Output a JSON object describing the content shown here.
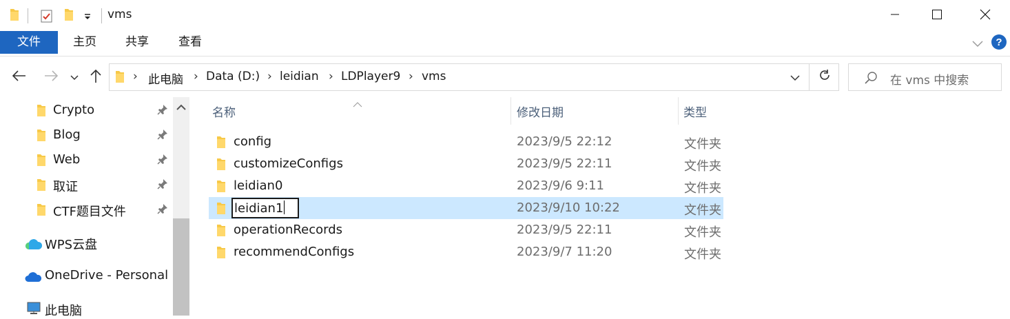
{
  "window": {
    "title": "vms",
    "icons": [
      "folder-icon",
      "properties-icon",
      "new-folder-icon",
      "customize-dropdown-icon"
    ],
    "controls": [
      "minimize-icon",
      "maximize-icon",
      "close-icon"
    ]
  },
  "ribbon": {
    "tabs": [
      {
        "label": "文件",
        "active": true
      },
      {
        "label": "主页"
      },
      {
        "label": "共享"
      },
      {
        "label": "查看"
      }
    ],
    "accent_color": "#1e66c0"
  },
  "address": {
    "breadcrumbs": [
      "此电脑",
      "Data (D:)",
      "leidian",
      "LDPlayer9",
      "vms"
    ],
    "search_placeholder": "在 vms 中搜索"
  },
  "navpane": {
    "quick_access": [
      {
        "label": "Crypto",
        "pinned": true
      },
      {
        "label": "Blog",
        "pinned": true
      },
      {
        "label": "Web",
        "pinned": true
      },
      {
        "label": "取证",
        "pinned": true
      },
      {
        "label": "CTF题目文件",
        "pinned": true
      }
    ],
    "locations": [
      {
        "label": "WPS云盘",
        "icon": "cloud-icon"
      },
      {
        "label": "OneDrive - Personal",
        "icon": "onedrive-icon"
      },
      {
        "label": "此电脑",
        "icon": "computer-icon"
      }
    ]
  },
  "filelist": {
    "columns": {
      "name": "名称",
      "date": "修改日期",
      "type": "类型"
    },
    "rows": [
      {
        "name": "config",
        "date": "2023/9/5 22:12",
        "type": "文件夹"
      },
      {
        "name": "customizeConfigs",
        "date": "2023/9/5 22:11",
        "type": "文件夹"
      },
      {
        "name": "leidian0",
        "date": "2023/9/6 9:11",
        "type": "文件夹"
      },
      {
        "name": "leidian1",
        "date": "2023/9/10 10:22",
        "type": "文件夹",
        "selected": true,
        "renaming": true
      },
      {
        "name": "operationRecords",
        "date": "2023/9/5 22:11",
        "type": "文件夹"
      },
      {
        "name": "recommendConfigs",
        "date": "2023/9/7 11:20",
        "type": "文件夹"
      }
    ],
    "selection_color": "#cce8ff"
  }
}
